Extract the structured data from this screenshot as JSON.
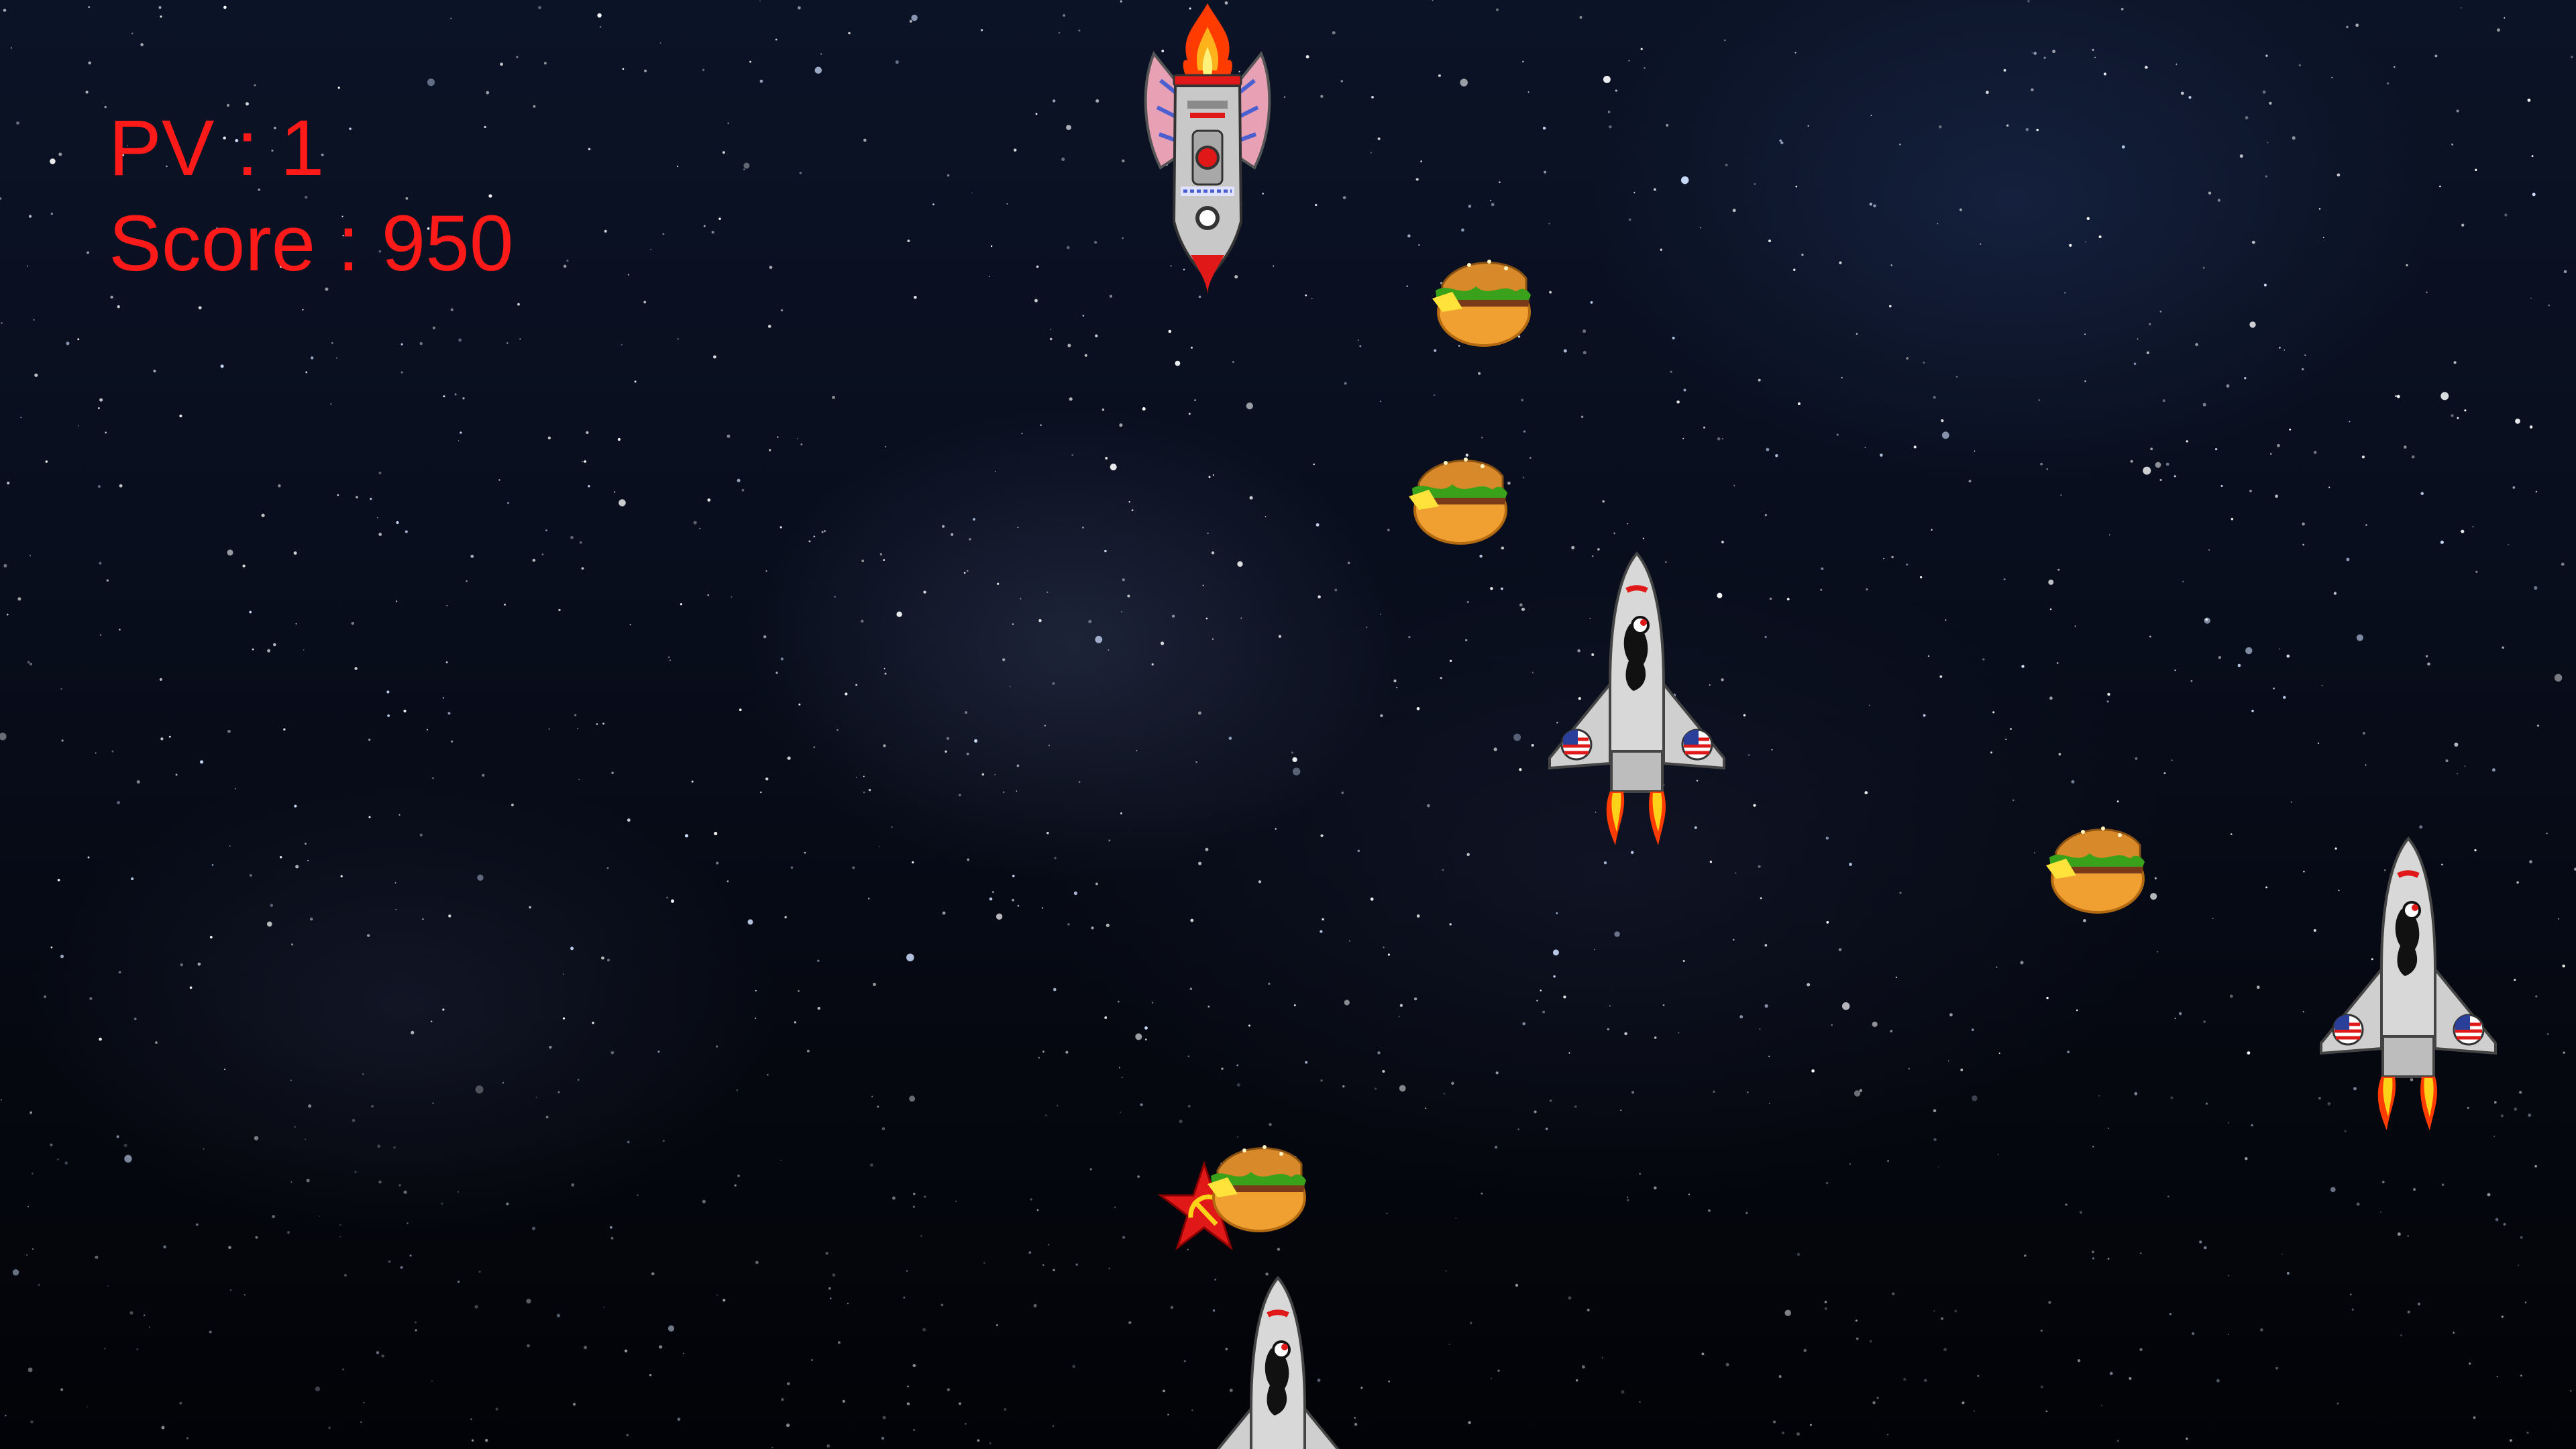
{
  "hud": {
    "pv_label": "PV",
    "pv_value": "1",
    "score_label": "Score",
    "score_value": "950",
    "separator": " : ",
    "color": "#ff1a1a"
  },
  "sprites": {
    "player": "rocket-ship-icon",
    "enemy": "space-shuttle-icon",
    "projectile": "burger-icon",
    "hit_effect": "red-star-hammer-sickle-icon"
  },
  "colors": {
    "background": "#05070e",
    "flame_outer": "#ff3b00",
    "flame_inner": "#ffd21a",
    "hull": "#c8c8c8",
    "accent_red": "#e01818",
    "burger_bun": "#f0a030",
    "lettuce": "#3aa11a"
  }
}
